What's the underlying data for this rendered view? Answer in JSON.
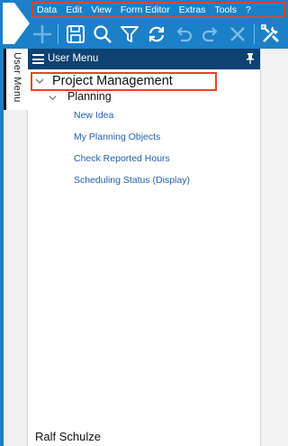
{
  "menu": {
    "items": [
      "Data",
      "Edit",
      "View",
      "Form Editor",
      "Extras",
      "Tools",
      "?"
    ]
  },
  "toolbar": {
    "icons": [
      "plus-icon",
      "save-icon",
      "search-icon",
      "filter-icon",
      "refresh-icon",
      "undo-icon",
      "redo-icon",
      "close-icon",
      "tools-icon"
    ]
  },
  "rail": {
    "tab_label": "User Menu"
  },
  "panel": {
    "title": "User Menu",
    "tree": {
      "root_label": "Project Management",
      "group_label": "Planning",
      "leaves": [
        "New Idea",
        "My Planning Objects",
        "Check Reported Hours",
        "Scheduling Status (Display)"
      ]
    },
    "user_name": "Ralf Schulze"
  },
  "colors": {
    "header_blue": "#1b80c8",
    "panel_header": "#0e4272",
    "link": "#1f5fae",
    "highlight": "#e8432c"
  }
}
